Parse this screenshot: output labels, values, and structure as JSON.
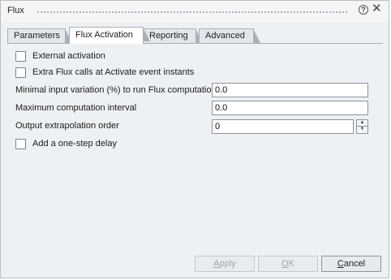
{
  "window": {
    "title": "Flux"
  },
  "icons": {
    "help": "help-circle-icon",
    "close": "close-icon"
  },
  "tabs": [
    {
      "label": "Parameters"
    },
    {
      "label": "Flux Activation"
    },
    {
      "label": "Reporting"
    },
    {
      "label": "Advanced"
    }
  ],
  "activation": {
    "external_activation": {
      "label": "External activation",
      "checked": false
    },
    "extra_calls": {
      "label": "Extra Flux calls at Activate event instants",
      "checked": false
    },
    "min_input_variation": {
      "label": "Minimal input variation (%) to run Flux computations",
      "value": "0.0"
    },
    "max_interval": {
      "label": "Maximum computation interval",
      "value": "0.0"
    },
    "extrapolation_order": {
      "label": "Output extrapolation order",
      "value": "0"
    },
    "one_step_delay": {
      "label": "Add a one-step delay",
      "checked": false
    }
  },
  "buttons": {
    "apply": {
      "first": "A",
      "rest": "pply",
      "enabled": false
    },
    "ok": {
      "first": "O",
      "rest": "K",
      "enabled": false
    },
    "cancel": {
      "first": "C",
      "rest": "ancel",
      "enabled": true
    }
  },
  "colors": {
    "panel": "#eef1f4",
    "border": "#a9b0b9",
    "disabled_text": "#9ea4ac"
  }
}
